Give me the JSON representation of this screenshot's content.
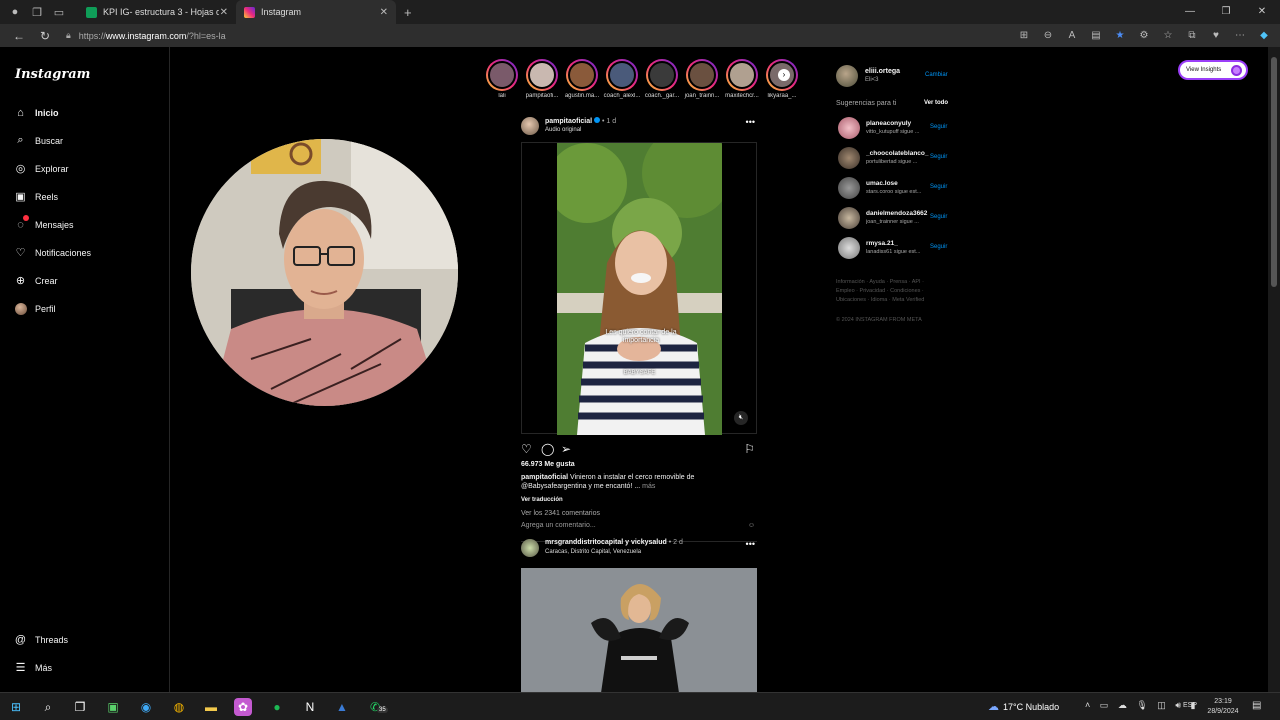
{
  "browser": {
    "tabs": [
      {
        "label": "KPI IG- estructura 3 - Hojas de cá",
        "favicon_color": "#0f9d58"
      },
      {
        "label": "Instagram",
        "favicon_color": "#e1306c"
      }
    ],
    "url_prefix": "https://",
    "url_host": "www.instagram.com",
    "url_path": "/?hl=es-la"
  },
  "sidebar": {
    "logo": "Instagram",
    "items": [
      {
        "label": "Inicio",
        "icon": "home-icon"
      },
      {
        "label": "Buscar",
        "icon": "search-icon"
      },
      {
        "label": "Explorar",
        "icon": "compass-icon"
      },
      {
        "label": "Reels",
        "icon": "reels-icon"
      },
      {
        "label": "Mensajes",
        "icon": "messenger-icon"
      },
      {
        "label": "Notificaciones",
        "icon": "heart-icon"
      },
      {
        "label": "Crear",
        "icon": "plus-icon"
      },
      {
        "label": "Perfil",
        "icon": "avatar"
      }
    ],
    "threads": "Threads",
    "more": "Más"
  },
  "stories": [
    {
      "name": "lali"
    },
    {
      "name": "pampitaofi..."
    },
    {
      "name": "agustin.ma..."
    },
    {
      "name": "coach_alexl..."
    },
    {
      "name": "coach._gar..."
    },
    {
      "name": "joan_trainn..."
    },
    {
      "name": "maxitechcr..."
    },
    {
      "name": "likyaraa_..."
    }
  ],
  "post1": {
    "user": "pampitaoficial",
    "time": "• 1 d",
    "sub": "Audio original",
    "likes": "66.973 Me gusta",
    "caption_user": "pampitaoficial",
    "caption_text": "Vinieron a instalar el cerco removible de @Babysafeargentina y me encantó! ...",
    "caption_more": "más",
    "translate": "Ver traducción",
    "comments": "Ver los 2341 comentarios",
    "add_comment": "Agrega un comentario...",
    "overlay_text": "Les quiero contar de la importancia",
    "shirt_text": "BABYSAFE"
  },
  "post2": {
    "user": "mrsgranddistritocapital y vickysalud",
    "time": "• 2 d",
    "sub": "Caracas, Distrito Capital, Venezuela"
  },
  "rail": {
    "me_name": "eliii.ortega",
    "me_sub": "Eli<3",
    "switch": "Cambiar",
    "sugg_title": "Sugerencias para ti",
    "sugg_all": "Ver todo",
    "suggestions": [
      {
        "name": "planeaconyuly",
        "sub": "vitto_kutupuff sigue ...",
        "follow": "Seguir"
      },
      {
        "name": "_choocolateblanco_",
        "sub": "portulibertad sigue ...",
        "follow": "Seguir"
      },
      {
        "name": "umac.lose",
        "sub": "stars.coroo sigue est...",
        "follow": "Seguir"
      },
      {
        "name": "danielmendoza3662",
        "sub": "joan_trainner sigue ...",
        "follow": "Seguir"
      },
      {
        "name": "rmysa.21_",
        "sub": "lanadiss61 sigue est...",
        "follow": "Seguir"
      }
    ],
    "footer": "Información · Ayuda · Prensa · API · Empleo · Privacidad · Condiciones · Ubicaciones · Idioma · Meta Verified",
    "copyright": "© 2024 INSTAGRAM FROM META"
  },
  "insights": "View Insights",
  "taskbar": {
    "weather": "17°C  Nublado",
    "lang": "ESP",
    "time": "23:19",
    "date": "28/9/2024",
    "whatsapp_badge": "35"
  }
}
